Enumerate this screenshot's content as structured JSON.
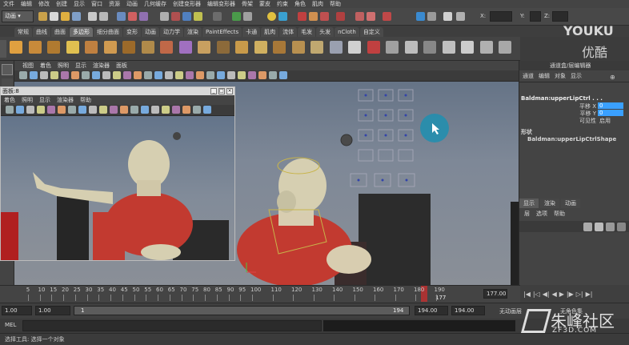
{
  "menubar": [
    "文件",
    "编辑",
    "修改",
    "创建",
    "显示",
    "窗口",
    "资源",
    "动画",
    "几何缓存",
    "创建变形器",
    "编辑变形器",
    "骨架",
    "蒙皮",
    "约束",
    "角色",
    "肌肉",
    "帮助"
  ],
  "status": {
    "mode": "动画",
    "x_label": "X:",
    "y_label": "Y:",
    "z_label": "Z:"
  },
  "watermark": {
    "brand": "YOUKU",
    "brand_cn": "优酷",
    "site": "朱峰社区",
    "site_url": "ZF3D.COM"
  },
  "shelf_tabs": [
    "常规",
    "曲线",
    "曲面",
    "多边形",
    "细分曲面",
    "变形",
    "动画",
    "动力学",
    "渲染",
    "PaintEffects",
    "卡通",
    "肌肉",
    "流体",
    "毛发",
    "头发",
    "nCloth",
    "自定义"
  ],
  "shelf_active": 3,
  "viewport": {
    "menu": [
      "视图",
      "着色",
      "照明",
      "显示",
      "渲染器",
      "面板"
    ]
  },
  "float_panel": {
    "title": "面板:8",
    "menu": [
      "着色",
      "照明",
      "显示",
      "渲染器",
      "帮助"
    ]
  },
  "channel_box": {
    "title": "通道盒/层编辑器",
    "menu": [
      "通道",
      "编辑",
      "对象",
      "显示"
    ],
    "object": "Baldman:upperLipCtrl . . .",
    "attrs": [
      {
        "name": "平移 X",
        "value": "0"
      },
      {
        "name": "平移 Y",
        "value": "0"
      },
      {
        "name": "可见性",
        "value": "启用"
      }
    ],
    "shapes_header": "形状",
    "shape": "Baldman:upperLipCtrlShape",
    "layer_tabs": [
      "显示",
      "渲染",
      "动画"
    ],
    "layer_menu": [
      "层",
      "选项",
      "帮助"
    ]
  },
  "timeline": {
    "ticks": [
      "5",
      "10",
      "15",
      "20",
      "25",
      "30",
      "35",
      "40",
      "45",
      "50",
      "55",
      "60",
      "65",
      "70",
      "75",
      "80",
      "85",
      "90",
      "95",
      "100",
      "110",
      "120",
      "130",
      "140",
      "150",
      "160",
      "170",
      "180",
      "190"
    ],
    "current": "177",
    "end_field": "177.00"
  },
  "range": {
    "start": "1.00",
    "start2": "1.00",
    "range_start_num": "1",
    "range_end_num": "194",
    "end": "194.00",
    "end2": "194.00",
    "anim_layer": "无动画层",
    "char_set": "无角色集"
  },
  "mel": {
    "label": "MEL"
  },
  "help": "选择工具: 选择一个对象"
}
